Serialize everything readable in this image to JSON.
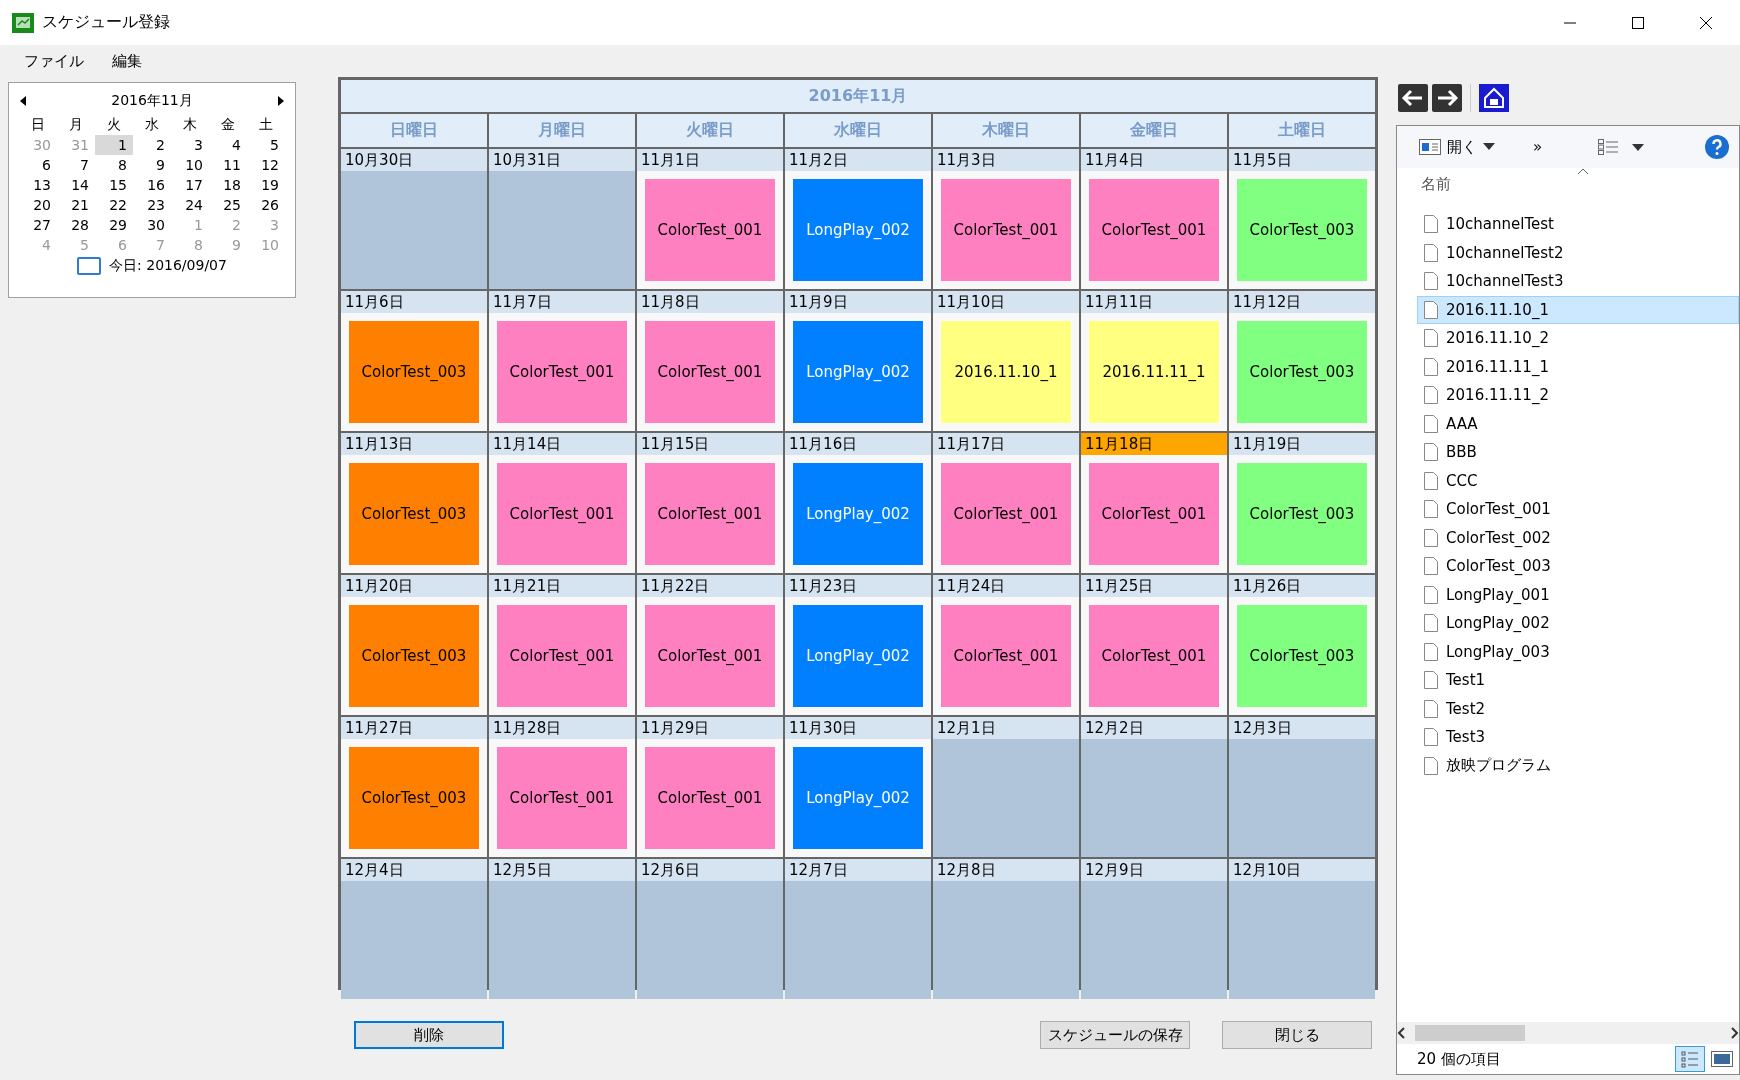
{
  "window": {
    "title": "スケジュール登録"
  },
  "menu": [
    "ファイル",
    "編集"
  ],
  "mini_calendar": {
    "month": "2016年11月",
    "weekdays": [
      "日",
      "月",
      "火",
      "水",
      "木",
      "金",
      "土"
    ],
    "days": [
      {
        "label": "30",
        "muted": true,
        "selected": false
      },
      {
        "label": "31",
        "muted": true,
        "selected": false
      },
      {
        "label": "1",
        "muted": false,
        "selected": true
      },
      {
        "label": "2",
        "muted": false,
        "selected": false
      },
      {
        "label": "3",
        "muted": false,
        "selected": false
      },
      {
        "label": "4",
        "muted": false,
        "selected": false
      },
      {
        "label": "5",
        "muted": false,
        "selected": false
      },
      {
        "label": "6",
        "muted": false,
        "selected": false
      },
      {
        "label": "7",
        "muted": false,
        "selected": false
      },
      {
        "label": "8",
        "muted": false,
        "selected": false
      },
      {
        "label": "9",
        "muted": false,
        "selected": false
      },
      {
        "label": "10",
        "muted": false,
        "selected": false
      },
      {
        "label": "11",
        "muted": false,
        "selected": false
      },
      {
        "label": "12",
        "muted": false,
        "selected": false
      },
      {
        "label": "13",
        "muted": false,
        "selected": false
      },
      {
        "label": "14",
        "muted": false,
        "selected": false
      },
      {
        "label": "15",
        "muted": false,
        "selected": false
      },
      {
        "label": "16",
        "muted": false,
        "selected": false
      },
      {
        "label": "17",
        "muted": false,
        "selected": false
      },
      {
        "label": "18",
        "muted": false,
        "selected": false
      },
      {
        "label": "19",
        "muted": false,
        "selected": false
      },
      {
        "label": "20",
        "muted": false,
        "selected": false
      },
      {
        "label": "21",
        "muted": false,
        "selected": false
      },
      {
        "label": "22",
        "muted": false,
        "selected": false
      },
      {
        "label": "23",
        "muted": false,
        "selected": false
      },
      {
        "label": "24",
        "muted": false,
        "selected": false
      },
      {
        "label": "25",
        "muted": false,
        "selected": false
      },
      {
        "label": "26",
        "muted": false,
        "selected": false
      },
      {
        "label": "27",
        "muted": false,
        "selected": false
      },
      {
        "label": "28",
        "muted": false,
        "selected": false
      },
      {
        "label": "29",
        "muted": false,
        "selected": false
      },
      {
        "label": "30",
        "muted": false,
        "selected": false
      },
      {
        "label": "1",
        "muted": true,
        "selected": false
      },
      {
        "label": "2",
        "muted": true,
        "selected": false
      },
      {
        "label": "3",
        "muted": true,
        "selected": false
      },
      {
        "label": "4",
        "muted": true,
        "selected": false
      },
      {
        "label": "5",
        "muted": true,
        "selected": false
      },
      {
        "label": "6",
        "muted": true,
        "selected": false
      },
      {
        "label": "7",
        "muted": true,
        "selected": false
      },
      {
        "label": "8",
        "muted": true,
        "selected": false
      },
      {
        "label": "9",
        "muted": true,
        "selected": false
      },
      {
        "label": "10",
        "muted": true,
        "selected": false
      }
    ],
    "today": "今日: 2016/09/07"
  },
  "calendar": {
    "month": "2016年11月",
    "weekdays": [
      "日曜日",
      "月曜日",
      "火曜日",
      "水曜日",
      "木曜日",
      "金曜日",
      "土曜日"
    ],
    "weeks": [
      [
        {
          "date": "10月30日",
          "in_month": false,
          "selected": false
        },
        {
          "date": "10月31日",
          "in_month": false,
          "selected": false
        },
        {
          "date": "11月1日",
          "in_month": true,
          "selected": false,
          "event": {
            "title": "ColorTest_001",
            "color": "#ff80c0"
          }
        },
        {
          "date": "11月2日",
          "in_month": true,
          "selected": false,
          "event": {
            "title": "LongPlay_002",
            "color": "#0080ff"
          }
        },
        {
          "date": "11月3日",
          "in_month": true,
          "selected": false,
          "event": {
            "title": "ColorTest_001",
            "color": "#ff80c0"
          }
        },
        {
          "date": "11月4日",
          "in_month": true,
          "selected": false,
          "event": {
            "title": "ColorTest_001",
            "color": "#ff80c0"
          }
        },
        {
          "date": "11月5日",
          "in_month": true,
          "selected": false,
          "event": {
            "title": "ColorTest_003",
            "color": "#80ff80"
          }
        }
      ],
      [
        {
          "date": "11月6日",
          "in_month": true,
          "selected": false,
          "event": {
            "title": "ColorTest_003",
            "color": "#ff8000"
          }
        },
        {
          "date": "11月7日",
          "in_month": true,
          "selected": false,
          "event": {
            "title": "ColorTest_001",
            "color": "#ff80c0"
          }
        },
        {
          "date": "11月8日",
          "in_month": true,
          "selected": false,
          "event": {
            "title": "ColorTest_001",
            "color": "#ff80c0"
          }
        },
        {
          "date": "11月9日",
          "in_month": true,
          "selected": false,
          "event": {
            "title": "LongPlay_002",
            "color": "#0080ff"
          }
        },
        {
          "date": "11月10日",
          "in_month": true,
          "selected": false,
          "event": {
            "title": "2016.11.10_1",
            "color": "#ffff80"
          }
        },
        {
          "date": "11月11日",
          "in_month": true,
          "selected": false,
          "event": {
            "title": "2016.11.11_1",
            "color": "#ffff80"
          }
        },
        {
          "date": "11月12日",
          "in_month": true,
          "selected": false,
          "event": {
            "title": "ColorTest_003",
            "color": "#80ff80"
          }
        }
      ],
      [
        {
          "date": "11月13日",
          "in_month": true,
          "selected": false,
          "event": {
            "title": "ColorTest_003",
            "color": "#ff8000"
          }
        },
        {
          "date": "11月14日",
          "in_month": true,
          "selected": false,
          "event": {
            "title": "ColorTest_001",
            "color": "#ff80c0"
          }
        },
        {
          "date": "11月15日",
          "in_month": true,
          "selected": false,
          "event": {
            "title": "ColorTest_001",
            "color": "#ff80c0"
          }
        },
        {
          "date": "11月16日",
          "in_month": true,
          "selected": false,
          "event": {
            "title": "LongPlay_002",
            "color": "#0080ff"
          }
        },
        {
          "date": "11月17日",
          "in_month": true,
          "selected": false,
          "event": {
            "title": "ColorTest_001",
            "color": "#ff80c0"
          }
        },
        {
          "date": "11月18日",
          "in_month": true,
          "selected": true,
          "event": {
            "title": "ColorTest_001",
            "color": "#ff80c0"
          }
        },
        {
          "date": "11月19日",
          "in_month": true,
          "selected": false,
          "event": {
            "title": "ColorTest_003",
            "color": "#80ff80"
          }
        }
      ],
      [
        {
          "date": "11月20日",
          "in_month": true,
          "selected": false,
          "event": {
            "title": "ColorTest_003",
            "color": "#ff8000"
          }
        },
        {
          "date": "11月21日",
          "in_month": true,
          "selected": false,
          "event": {
            "title": "ColorTest_001",
            "color": "#ff80c0"
          }
        },
        {
          "date": "11月22日",
          "in_month": true,
          "selected": false,
          "event": {
            "title": "ColorTest_001",
            "color": "#ff80c0"
          }
        },
        {
          "date": "11月23日",
          "in_month": true,
          "selected": false,
          "event": {
            "title": "LongPlay_002",
            "color": "#0080ff"
          }
        },
        {
          "date": "11月24日",
          "in_month": true,
          "selected": false,
          "event": {
            "title": "ColorTest_001",
            "color": "#ff80c0"
          }
        },
        {
          "date": "11月25日",
          "in_month": true,
          "selected": false,
          "event": {
            "title": "ColorTest_001",
            "color": "#ff80c0"
          }
        },
        {
          "date": "11月26日",
          "in_month": true,
          "selected": false,
          "event": {
            "title": "ColorTest_003",
            "color": "#80ff80"
          }
        }
      ],
      [
        {
          "date": "11月27日",
          "in_month": true,
          "selected": false,
          "event": {
            "title": "ColorTest_003",
            "color": "#ff8000"
          }
        },
        {
          "date": "11月28日",
          "in_month": true,
          "selected": false,
          "event": {
            "title": "ColorTest_001",
            "color": "#ff80c0"
          }
        },
        {
          "date": "11月29日",
          "in_month": true,
          "selected": false,
          "event": {
            "title": "ColorTest_001",
            "color": "#ff80c0"
          }
        },
        {
          "date": "11月30日",
          "in_month": true,
          "selected": false,
          "event": {
            "title": "LongPlay_002",
            "color": "#0080ff"
          }
        },
        {
          "date": "12月1日",
          "in_month": false,
          "selected": false
        },
        {
          "date": "12月2日",
          "in_month": false,
          "selected": false
        },
        {
          "date": "12月3日",
          "in_month": false,
          "selected": false
        }
      ],
      [
        {
          "date": "12月4日",
          "in_month": false,
          "selected": false
        },
        {
          "date": "12月5日",
          "in_month": false,
          "selected": false
        },
        {
          "date": "12月6日",
          "in_month": false,
          "selected": false
        },
        {
          "date": "12月7日",
          "in_month": false,
          "selected": false
        },
        {
          "date": "12月8日",
          "in_month": false,
          "selected": false
        },
        {
          "date": "12月9日",
          "in_month": false,
          "selected": false
        },
        {
          "date": "12月10日",
          "in_month": false,
          "selected": false
        }
      ]
    ]
  },
  "buttons": {
    "delete": "削除",
    "save": "スケジュールの保存",
    "close": "閉じる"
  },
  "explorer": {
    "open": "開く",
    "more": "»",
    "column": "名前",
    "files": [
      {
        "name": "10channelTest",
        "selected": false
      },
      {
        "name": "10channelTest2",
        "selected": false
      },
      {
        "name": "10channelTest3",
        "selected": false
      },
      {
        "name": "2016.11.10_1",
        "selected": true
      },
      {
        "name": "2016.11.10_2",
        "selected": false
      },
      {
        "name": "2016.11.11_1",
        "selected": false
      },
      {
        "name": "2016.11.11_2",
        "selected": false
      },
      {
        "name": "AAA",
        "selected": false
      },
      {
        "name": "BBB",
        "selected": false
      },
      {
        "name": "CCC",
        "selected": false
      },
      {
        "name": "ColorTest_001",
        "selected": false
      },
      {
        "name": "ColorTest_002",
        "selected": false
      },
      {
        "name": "ColorTest_003",
        "selected": false
      },
      {
        "name": "LongPlay_001",
        "selected": false
      },
      {
        "name": "LongPlay_002",
        "selected": false
      },
      {
        "name": "LongPlay_003",
        "selected": false
      },
      {
        "name": "Test1",
        "selected": false
      },
      {
        "name": "Test2",
        "selected": false
      },
      {
        "name": "Test3",
        "selected": false
      },
      {
        "name": "放映プログラム",
        "selected": false
      }
    ],
    "status": "20 個の項目"
  }
}
